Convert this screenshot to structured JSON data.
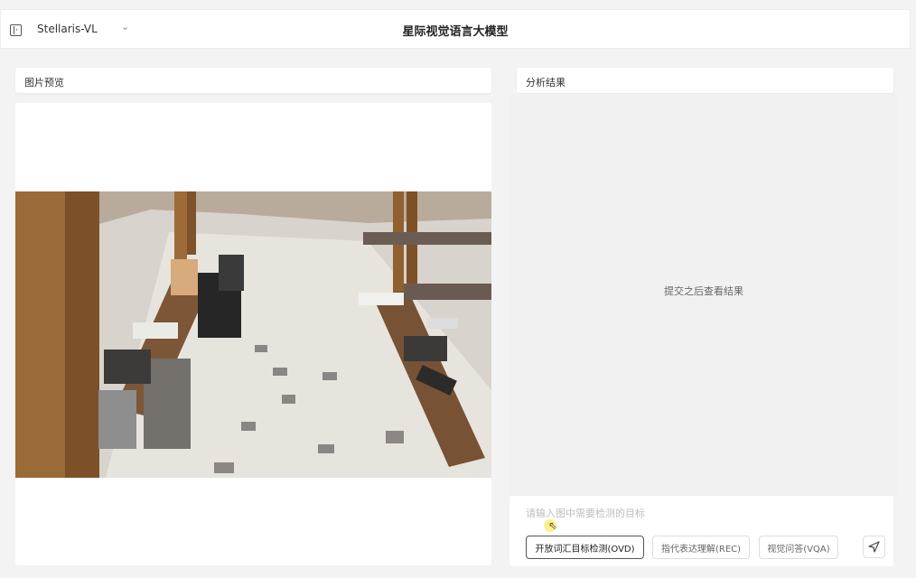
{
  "header": {
    "sidebar_toggle_icon": "sidebar-collapse-icon",
    "model_name": "Stellaris-VL",
    "model_dropdown_icon": "chevron-down-icon",
    "title": "星际视觉语言大模型"
  },
  "left_panel": {
    "title": "图片预览",
    "image_alt": "outdoor plaza with wooden benches, luggage and backpacks"
  },
  "right_panel": {
    "title": "分析结果",
    "empty_text": "提交之后查看结果"
  },
  "input": {
    "placeholder": "请输入图中需要检测的目标",
    "value": ""
  },
  "modes": [
    {
      "label": "开放词汇目标检测(OVD)",
      "active": true
    },
    {
      "label": "指代表达理解(REC)",
      "active": false
    },
    {
      "label": "视觉问答(VQA)",
      "active": false
    }
  ],
  "send_icon": "send-icon",
  "colors": {
    "background": "#f3f3f4",
    "panel": "#ffffff",
    "accent": "#555555"
  }
}
